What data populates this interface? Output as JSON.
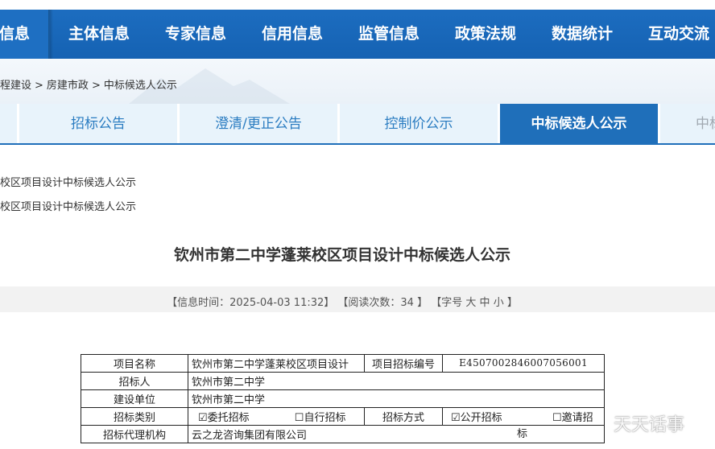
{
  "nav": {
    "items": [
      {
        "label": "息信息"
      },
      {
        "label": "主体信息"
      },
      {
        "label": "专家信息"
      },
      {
        "label": "信用信息"
      },
      {
        "label": "监管信息"
      },
      {
        "label": "政策法规"
      },
      {
        "label": "数据统计"
      },
      {
        "label": "互动交流"
      }
    ]
  },
  "breadcrumb": {
    "items": [
      "程建设",
      ">",
      "房建市政",
      ">",
      "中标候选人公示"
    ]
  },
  "tabs": {
    "items": [
      {
        "label": "招标公告"
      },
      {
        "label": "澄清/更正公告"
      },
      {
        "label": "控制价公示"
      },
      {
        "label": "中标候选人公示"
      },
      {
        "label": "中标"
      }
    ]
  },
  "list": {
    "line1": "校区项目设计中标候选人公示",
    "line2": "校区项目设计中标候选人公示"
  },
  "article": {
    "title": "钦州市第二中学蓬莱校区项目设计中标候选人公示",
    "meta_time_label": "【信息时间：2025-04-03 11:32】",
    "meta_reads_label": "【阅读次数：34 】",
    "meta_font_open": "【字号",
    "font_large": "大",
    "font_medium": "中",
    "font_small": "小",
    "meta_font_close": "】"
  },
  "table": {
    "r1": {
      "k1": "项目名称",
      "v1": "钦州市第二中学蓬莱校区项目设计",
      "k2": "项目招标编号",
      "v2": "E4507002846007056001"
    },
    "r2": {
      "k1": "招标人",
      "v1": "钦州市第二中学"
    },
    "r3": {
      "k1": "建设单位",
      "v1": "钦州市第二中学"
    },
    "r4": {
      "k1": "招标类别",
      "opt1": "☑委托招标",
      "opt2": "☐自行招标",
      "k2": "招标方式",
      "opt3": "☑公开招标",
      "opt4": "☐邀请招",
      "opt4b": "标"
    },
    "r5": {
      "k1": "招标代理机构",
      "v1": "云之龙咨询集团有限公司"
    }
  },
  "watermark": {
    "text": "天天话事"
  },
  "colors": {
    "nav_blue": "#1e6fc2",
    "tab_active": "#1f6fba",
    "tab_bg": "#e8f3fb",
    "tab_text": "#2a7cc1"
  }
}
